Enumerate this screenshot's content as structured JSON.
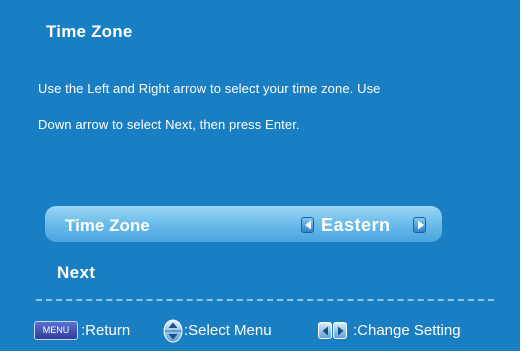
{
  "screen": {
    "background_color": "#1a7ec2",
    "title": "Time Zone",
    "instructions": [
      "Use the Left and Right arrow to select your time zone. Use",
      "Down arrow to select Next, then press Enter."
    ]
  },
  "timezone_row": {
    "label": "Time Zone",
    "value": "Eastern",
    "left_icon": "arrow-left-icon",
    "right_icon": "arrow-right-icon"
  },
  "next_label": "Next",
  "footer": {
    "menu_key": "MENU",
    "return_text": ":Return",
    "select_icon": "up-down-arrows-icon",
    "select_text": ":Select Menu",
    "change_icon": "left-right-arrows-icon",
    "change_text": ":Change Setting"
  }
}
